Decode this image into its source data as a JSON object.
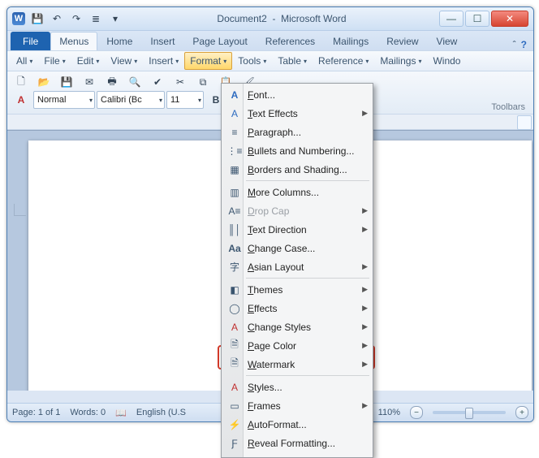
{
  "title": {
    "document": "Document2",
    "app": "Microsoft Word"
  },
  "ribbon_tabs": [
    "File",
    "Menus",
    "Home",
    "Insert",
    "Page Layout",
    "References",
    "Mailings",
    "Review",
    "View"
  ],
  "menus": [
    "All",
    "File",
    "Edit",
    "View",
    "Insert",
    "Format",
    "Tools",
    "Table",
    "Reference",
    "Mailings",
    "Windo"
  ],
  "toolbar": {
    "style": "Normal",
    "font": "Calibri (Bc",
    "size": "11",
    "group_label": "Toolbars"
  },
  "status": {
    "page_label": "Page:",
    "page_value": "1 of 1",
    "words_label": "Words:",
    "words_value": "0",
    "language": "English (U.S",
    "zoom": "110%"
  },
  "format_menu": [
    {
      "label": "Font...",
      "submenu": false,
      "disabled": false
    },
    {
      "label": "Text Effects",
      "submenu": true,
      "disabled": false
    },
    {
      "label": "Paragraph...",
      "submenu": false,
      "disabled": false
    },
    {
      "label": "Bullets and Numbering...",
      "submenu": false,
      "disabled": false
    },
    {
      "label": "Borders and Shading...",
      "submenu": false,
      "disabled": false
    },
    {
      "label": "More Columns...",
      "submenu": false,
      "disabled": false
    },
    {
      "label": "Drop Cap",
      "submenu": true,
      "disabled": true
    },
    {
      "label": "Text Direction",
      "submenu": true,
      "disabled": false
    },
    {
      "label": "Change Case...",
      "submenu": false,
      "disabled": false
    },
    {
      "label": "Asian Layout",
      "submenu": true,
      "disabled": false
    },
    {
      "label": "Themes",
      "submenu": true,
      "disabled": false
    },
    {
      "label": "Effects",
      "submenu": true,
      "disabled": false
    },
    {
      "label": "Change Styles",
      "submenu": true,
      "disabled": false
    },
    {
      "label": "Page Color",
      "submenu": true,
      "disabled": false
    },
    {
      "label": "Watermark",
      "submenu": true,
      "disabled": false
    },
    {
      "label": "Styles...",
      "submenu": false,
      "disabled": false
    },
    {
      "label": "Frames",
      "submenu": true,
      "disabled": false
    },
    {
      "label": "AutoFormat...",
      "submenu": false,
      "disabled": false
    },
    {
      "label": "Reveal Formatting...",
      "submenu": false,
      "disabled": false
    }
  ],
  "colors": {
    "accent": "#1e63b0",
    "highlight": "#ffd76b",
    "annotation": "#d43a2a"
  }
}
